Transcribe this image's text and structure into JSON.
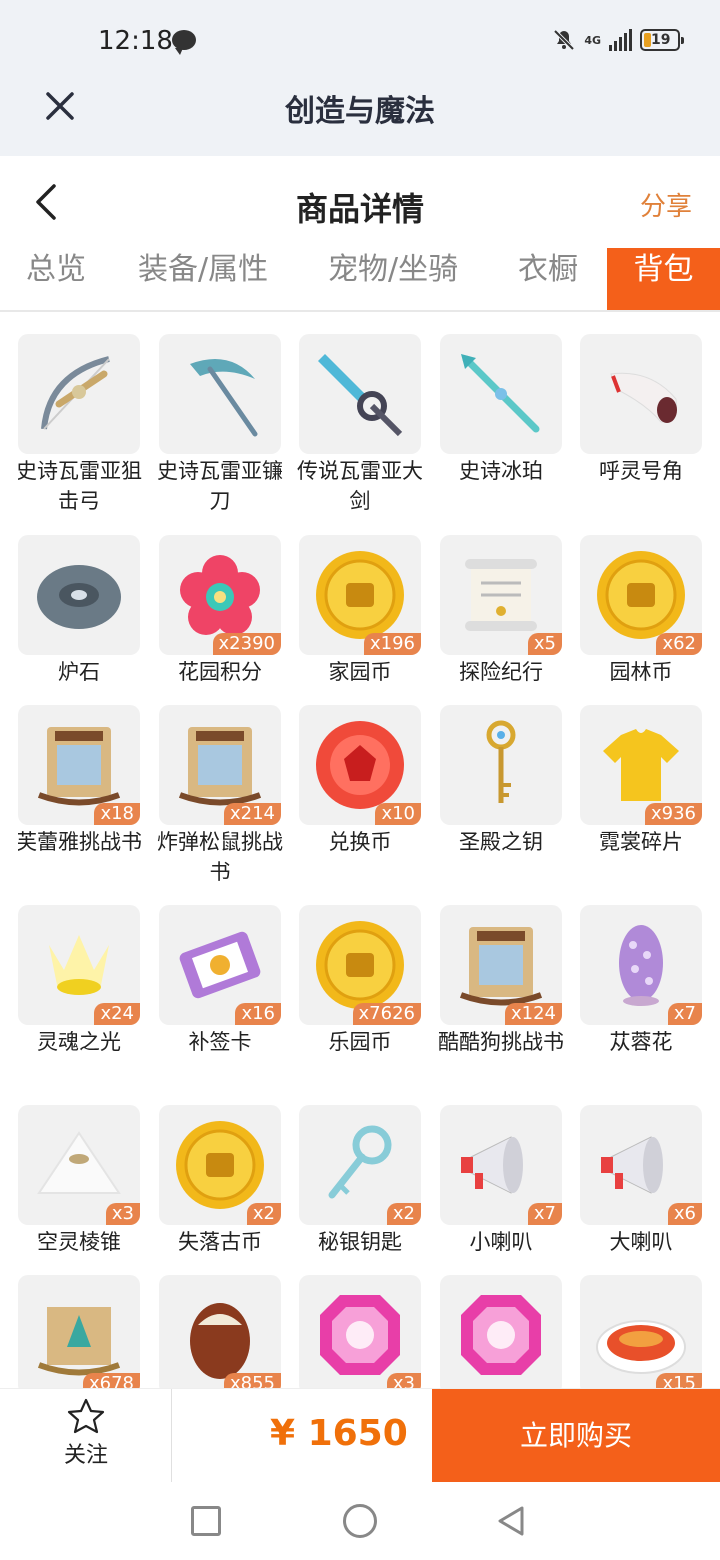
{
  "status": {
    "time": "12:18",
    "network": "4G",
    "battery": "19"
  },
  "app": {
    "title": "创造与魔法"
  },
  "detail": {
    "title": "商品详情",
    "share": "分享"
  },
  "tabs": [
    {
      "label": "总览"
    },
    {
      "label": "装备/属性"
    },
    {
      "label": "宠物/坐骑"
    },
    {
      "label": "衣橱"
    },
    {
      "label": "背包",
      "active": true
    }
  ],
  "items": [
    {
      "name": "史诗瓦雷亚狙击弓",
      "count": "",
      "icon": "bow-icon"
    },
    {
      "name": "史诗瓦雷亚镰刀",
      "count": "",
      "icon": "scythe-icon"
    },
    {
      "name": "传说瓦雷亚大剑",
      "count": "",
      "icon": "greatsword-icon"
    },
    {
      "name": "史诗冰珀",
      "count": "",
      "icon": "ice-spear-icon"
    },
    {
      "name": "呼灵号角",
      "count": "",
      "icon": "horn-icon"
    },
    {
      "name": "炉石",
      "count": "",
      "icon": "hearthstone-icon"
    },
    {
      "name": "花园积分",
      "count": "x2390",
      "icon": "flower-icon"
    },
    {
      "name": "家园币",
      "count": "x196",
      "icon": "gold-coin-icon"
    },
    {
      "name": "探险纪行",
      "count": "x5",
      "icon": "scroll-icon"
    },
    {
      "name": "园林币",
      "count": "x62",
      "icon": "gold-coin-icon"
    },
    {
      "name": "芙蕾雅挑战书",
      "count": "x18",
      "icon": "wanted-poster-icon"
    },
    {
      "name": "炸弹松鼠挑战书",
      "count": "x214",
      "icon": "wanted-poster-icon"
    },
    {
      "name": "兑换币",
      "count": "x10",
      "icon": "red-coin-icon"
    },
    {
      "name": "圣殿之钥",
      "count": "",
      "icon": "golden-key-icon"
    },
    {
      "name": "霓裳碎片",
      "count": "x936",
      "icon": "shirt-icon"
    },
    {
      "name": "灵魂之光",
      "count": "x24",
      "icon": "soul-light-icon"
    },
    {
      "name": "补签卡",
      "count": "x16",
      "icon": "ticket-icon"
    },
    {
      "name": "乐园币",
      "count": "x7626",
      "icon": "gold-coin-icon"
    },
    {
      "name": "酷酷狗挑战书",
      "count": "x124",
      "icon": "wanted-poster-icon"
    },
    {
      "name": "苁蓉花",
      "count": "x7",
      "icon": "cistanche-icon"
    },
    {
      "name": "空灵棱锥",
      "count": "x3",
      "icon": "pyramid-icon"
    },
    {
      "name": "失落古币",
      "count": "x2",
      "icon": "gold-coin-icon"
    },
    {
      "name": "秘银钥匙",
      "count": "x2",
      "icon": "mithril-key-icon"
    },
    {
      "name": "小喇叭",
      "count": "x7",
      "icon": "megaphone-icon"
    },
    {
      "name": "大喇叭",
      "count": "x6",
      "icon": "megaphone-icon"
    },
    {
      "name": "",
      "count": "x678",
      "icon": "gold-scroll-icon"
    },
    {
      "name": "",
      "count": "x855",
      "icon": "egg-icon"
    },
    {
      "name": "",
      "count": "x3",
      "icon": "gem-icon"
    },
    {
      "name": "",
      "count": "",
      "icon": "gem-icon"
    },
    {
      "name": "",
      "count": "x15",
      "icon": "fish-dish-icon"
    }
  ],
  "bottom": {
    "follow": "关注",
    "price": "¥ 1650",
    "buy": "立即购买"
  },
  "colors": {
    "accent": "#f4601a",
    "price": "#f0700a",
    "badge": "#e8844c",
    "share": "#e0813a"
  }
}
